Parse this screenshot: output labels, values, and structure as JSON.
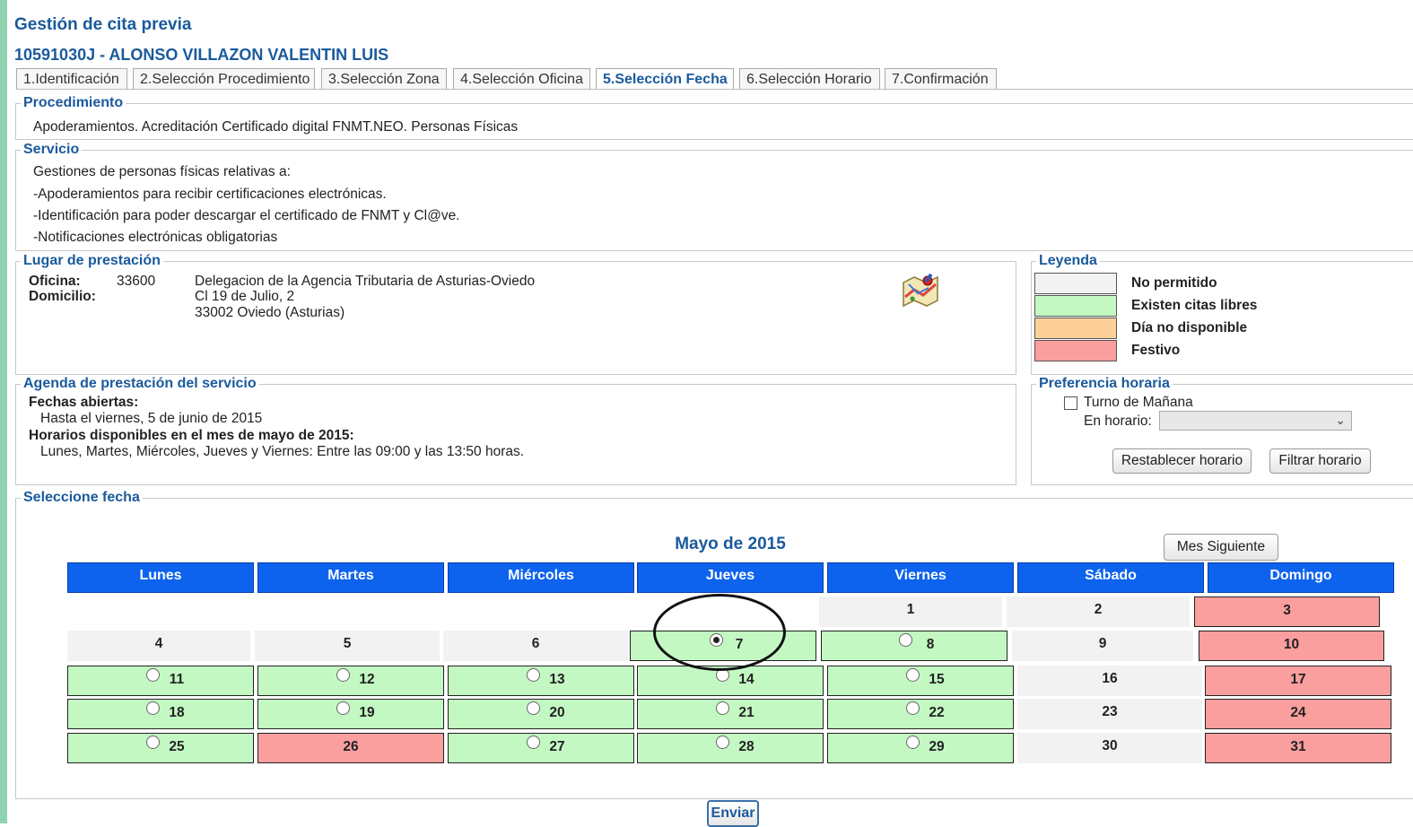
{
  "page": {
    "app_title": "Gestión de cita previa",
    "person": "10591030J - ALONSO VILLAZON VALENTIN LUIS"
  },
  "tabs": [
    {
      "label": "1.Identificación",
      "active": false
    },
    {
      "label": "2.Selección Procedimiento",
      "active": false
    },
    {
      "label": "3.Selección Zona",
      "active": false
    },
    {
      "label": "4.Selección Oficina",
      "active": false
    },
    {
      "label": "5.Selección Fecha",
      "active": true
    },
    {
      "label": "6.Selección Horario",
      "active": false
    },
    {
      "label": "7.Confirmación",
      "active": false
    }
  ],
  "procedimiento": {
    "legend": "Procedimiento",
    "text": "Apoderamientos. Acreditación Certificado digital FNMT.NEO. Personas Físicas"
  },
  "servicio": {
    "legend": "Servicio",
    "lines": [
      "Gestiones de personas físicas relativas a:",
      "-Apoderamientos para recibir certificaciones electrónicas.",
      "-Identificación para poder descargar el certificado de FNMT y Cl@ve.",
      "-Notificaciones electrónicas obligatorias"
    ]
  },
  "lugar": {
    "legend": "Lugar de prestación",
    "oficina_label": "Oficina:",
    "oficina_code": "33600",
    "domicilio_label": "Domicilio:",
    "address": [
      "Delegacion de la Agencia Tributaria de Asturias-Oviedo",
      "Cl 19 de Julio, 2",
      "33002 Oviedo (Asturias)"
    ],
    "icon": "map-icon"
  },
  "leyenda": {
    "legend": "Leyenda",
    "items": [
      {
        "label": "No permitido",
        "color": "#f2f2f2"
      },
      {
        "label": "Existen citas libres",
        "color": "#c3f8c3"
      },
      {
        "label": "Día no disponible",
        "color": "#fdd09a"
      },
      {
        "label": "Festivo",
        "color": "#fb9e9e"
      }
    ]
  },
  "agenda": {
    "legend": "Agenda de prestación del servicio",
    "fechas_label": "Fechas abiertas:",
    "fechas_value": "Hasta el viernes, 5 de junio de 2015",
    "horarios_label": "Horarios disponibles en el mes de mayo de 2015:",
    "horarios_value": "Lunes, Martes, Miércoles, Jueves y Viernes: Entre las 09:00 y las 13:50 horas."
  },
  "preferencia": {
    "legend": "Preferencia horaria",
    "turno_label": "Turno de Mañana",
    "turno_checked": false,
    "horario_label": "En horario:",
    "horario_value": "",
    "restablecer_label": "Restablecer horario",
    "filtrar_label": "Filtrar horario"
  },
  "calendar": {
    "legend": "Seleccione fecha",
    "month_title": "Mayo de 2015",
    "next_month_label": "Mes Siguiente",
    "submit_label": "Enviar",
    "day_names": [
      "Lunes",
      "Martes",
      "Miércoles",
      "Jueves",
      "Viernes",
      "Sábado",
      "Domingo"
    ],
    "selected_day": 7,
    "weeks": [
      [
        null,
        null,
        null,
        null,
        {
          "day": "1",
          "status": "np"
        },
        {
          "day": "2",
          "status": "np"
        },
        {
          "day": "3",
          "status": "festivo"
        }
      ],
      [
        {
          "day": "4",
          "status": "np"
        },
        {
          "day": "5",
          "status": "np"
        },
        {
          "day": "6",
          "status": "np"
        },
        {
          "day": "7",
          "status": "free"
        },
        {
          "day": "8",
          "status": "free"
        },
        {
          "day": "9",
          "status": "np"
        },
        {
          "day": "10",
          "status": "festivo"
        }
      ],
      [
        {
          "day": "11",
          "status": "free"
        },
        {
          "day": "12",
          "status": "free"
        },
        {
          "day": "13",
          "status": "free"
        },
        {
          "day": "14",
          "status": "free"
        },
        {
          "day": "15",
          "status": "free"
        },
        {
          "day": "16",
          "status": "np"
        },
        {
          "day": "17",
          "status": "festivo"
        }
      ],
      [
        {
          "day": "18",
          "status": "free"
        },
        {
          "day": "19",
          "status": "free"
        },
        {
          "day": "20",
          "status": "free"
        },
        {
          "day": "21",
          "status": "free"
        },
        {
          "day": "22",
          "status": "free"
        },
        {
          "day": "23",
          "status": "np"
        },
        {
          "day": "24",
          "status": "festivo"
        }
      ],
      [
        {
          "day": "25",
          "status": "free"
        },
        {
          "day": "26",
          "status": "festivo"
        },
        {
          "day": "27",
          "status": "free"
        },
        {
          "day": "28",
          "status": "free"
        },
        {
          "day": "29",
          "status": "free"
        },
        {
          "day": "30",
          "status": "np"
        },
        {
          "day": "31",
          "status": "festivo"
        }
      ]
    ]
  }
}
